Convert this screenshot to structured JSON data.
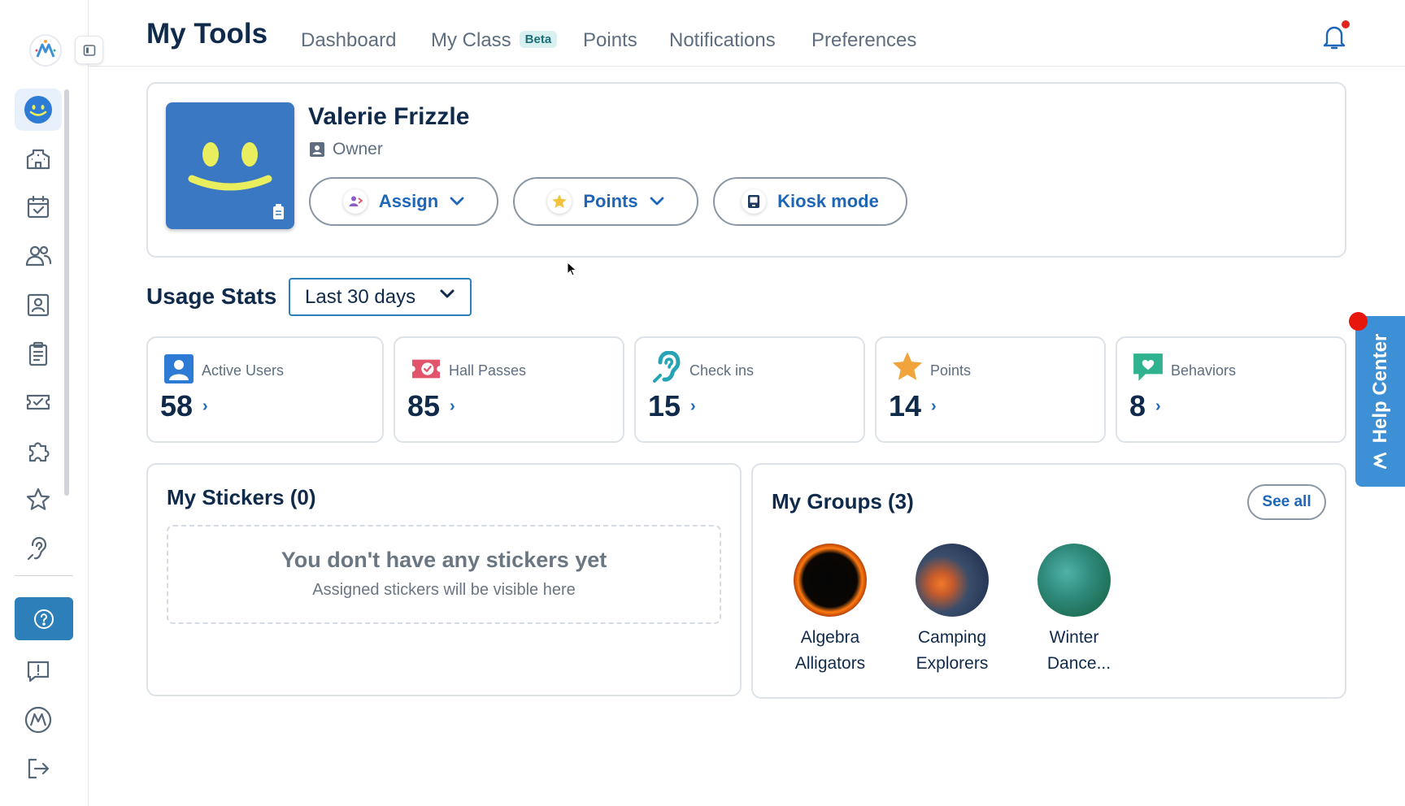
{
  "header": {
    "title": "My Tools",
    "tabs": [
      {
        "label": "Dashboard"
      },
      {
        "label": "My Class",
        "badge": "Beta"
      },
      {
        "label": "Points"
      },
      {
        "label": "Notifications"
      },
      {
        "label": "Preferences"
      }
    ]
  },
  "profile": {
    "name": "Valerie Frizzle",
    "role": "Owner",
    "buttons": {
      "assign": "Assign",
      "points": "Points",
      "kiosk": "Kiosk mode"
    }
  },
  "usage": {
    "title": "Usage Stats",
    "range": "Last 30 days",
    "stats": [
      {
        "label": "Active Users",
        "value": "58",
        "icon": "user-icon",
        "color": "#2e7bd6"
      },
      {
        "label": "Hall Passes",
        "value": "85",
        "icon": "ticket-icon",
        "color": "#e2536c"
      },
      {
        "label": "Check ins",
        "value": "15",
        "icon": "ear-icon",
        "color": "#26a3b5"
      },
      {
        "label": "Points",
        "value": "14",
        "icon": "star-icon",
        "color": "#f0a43b"
      },
      {
        "label": "Behaviors",
        "value": "8",
        "icon": "heart-chat-icon",
        "color": "#2fb28e"
      }
    ]
  },
  "stickers": {
    "title": "My Stickers (0)",
    "empty_title": "You don't have any stickers yet",
    "empty_sub": "Assigned stickers will be visible here"
  },
  "groups": {
    "title": "My Groups (3)",
    "see_all": "See all",
    "items": [
      {
        "line1": "Algebra",
        "line2": "Alligators"
      },
      {
        "line1": "Camping",
        "line2": "Explorers"
      },
      {
        "line1": "Winter",
        "line2": "Dance..."
      }
    ]
  },
  "help_center": {
    "label": "Help Center"
  },
  "colors": {
    "accent": "#1e66b8",
    "primary": "#0f2a4a",
    "help": "#3d8fd6",
    "alert": "#e0261c"
  }
}
